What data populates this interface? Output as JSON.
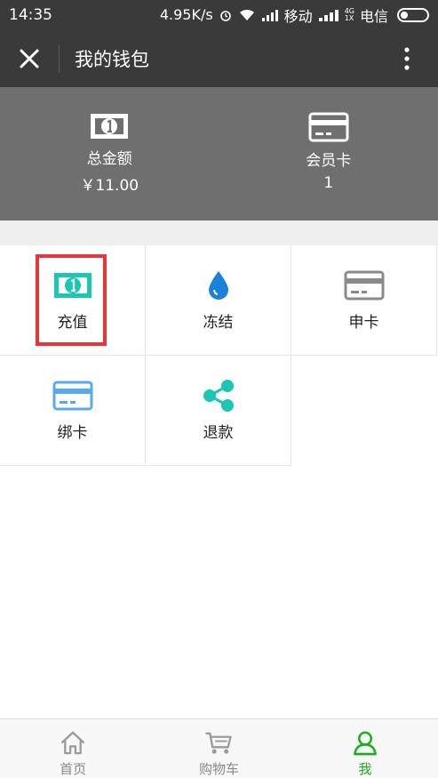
{
  "status_bar": {
    "time": "14:35",
    "speed": "4.95K/s",
    "carrier1": "移动",
    "net_top": "4G",
    "net_bottom": "1X",
    "carrier2": "电信"
  },
  "header": {
    "title": "我的钱包"
  },
  "summary": {
    "items": [
      {
        "label": "总金额",
        "value": "￥11.00",
        "icon": "banknote-icon"
      },
      {
        "label": "会员卡",
        "value": "1",
        "icon": "card-icon"
      }
    ]
  },
  "grid": {
    "items": [
      {
        "label": "充值",
        "icon": "banknote-icon",
        "color": "#1bc6b4",
        "highlighted": true
      },
      {
        "label": "冻结",
        "icon": "droplet-icon",
        "color": "#1a82d8"
      },
      {
        "label": "申卡",
        "icon": "card-icon",
        "color": "#8a8a8a"
      },
      {
        "label": "绑卡",
        "icon": "card-icon",
        "color": "#5aa9ef"
      },
      {
        "label": "退款",
        "icon": "share-icon",
        "color": "#1bc6b4"
      }
    ]
  },
  "tabbar": {
    "items": [
      {
        "label": "首页",
        "icon": "home-icon"
      },
      {
        "label": "购物车",
        "icon": "cart-icon"
      },
      {
        "label": "我",
        "icon": "user-icon",
        "active": true
      }
    ]
  },
  "colors": {
    "header_bg": "#3a3a3a",
    "summary_bg": "#6f6f6f",
    "highlight": "#e8353a",
    "active_tab": "#1aad19"
  }
}
